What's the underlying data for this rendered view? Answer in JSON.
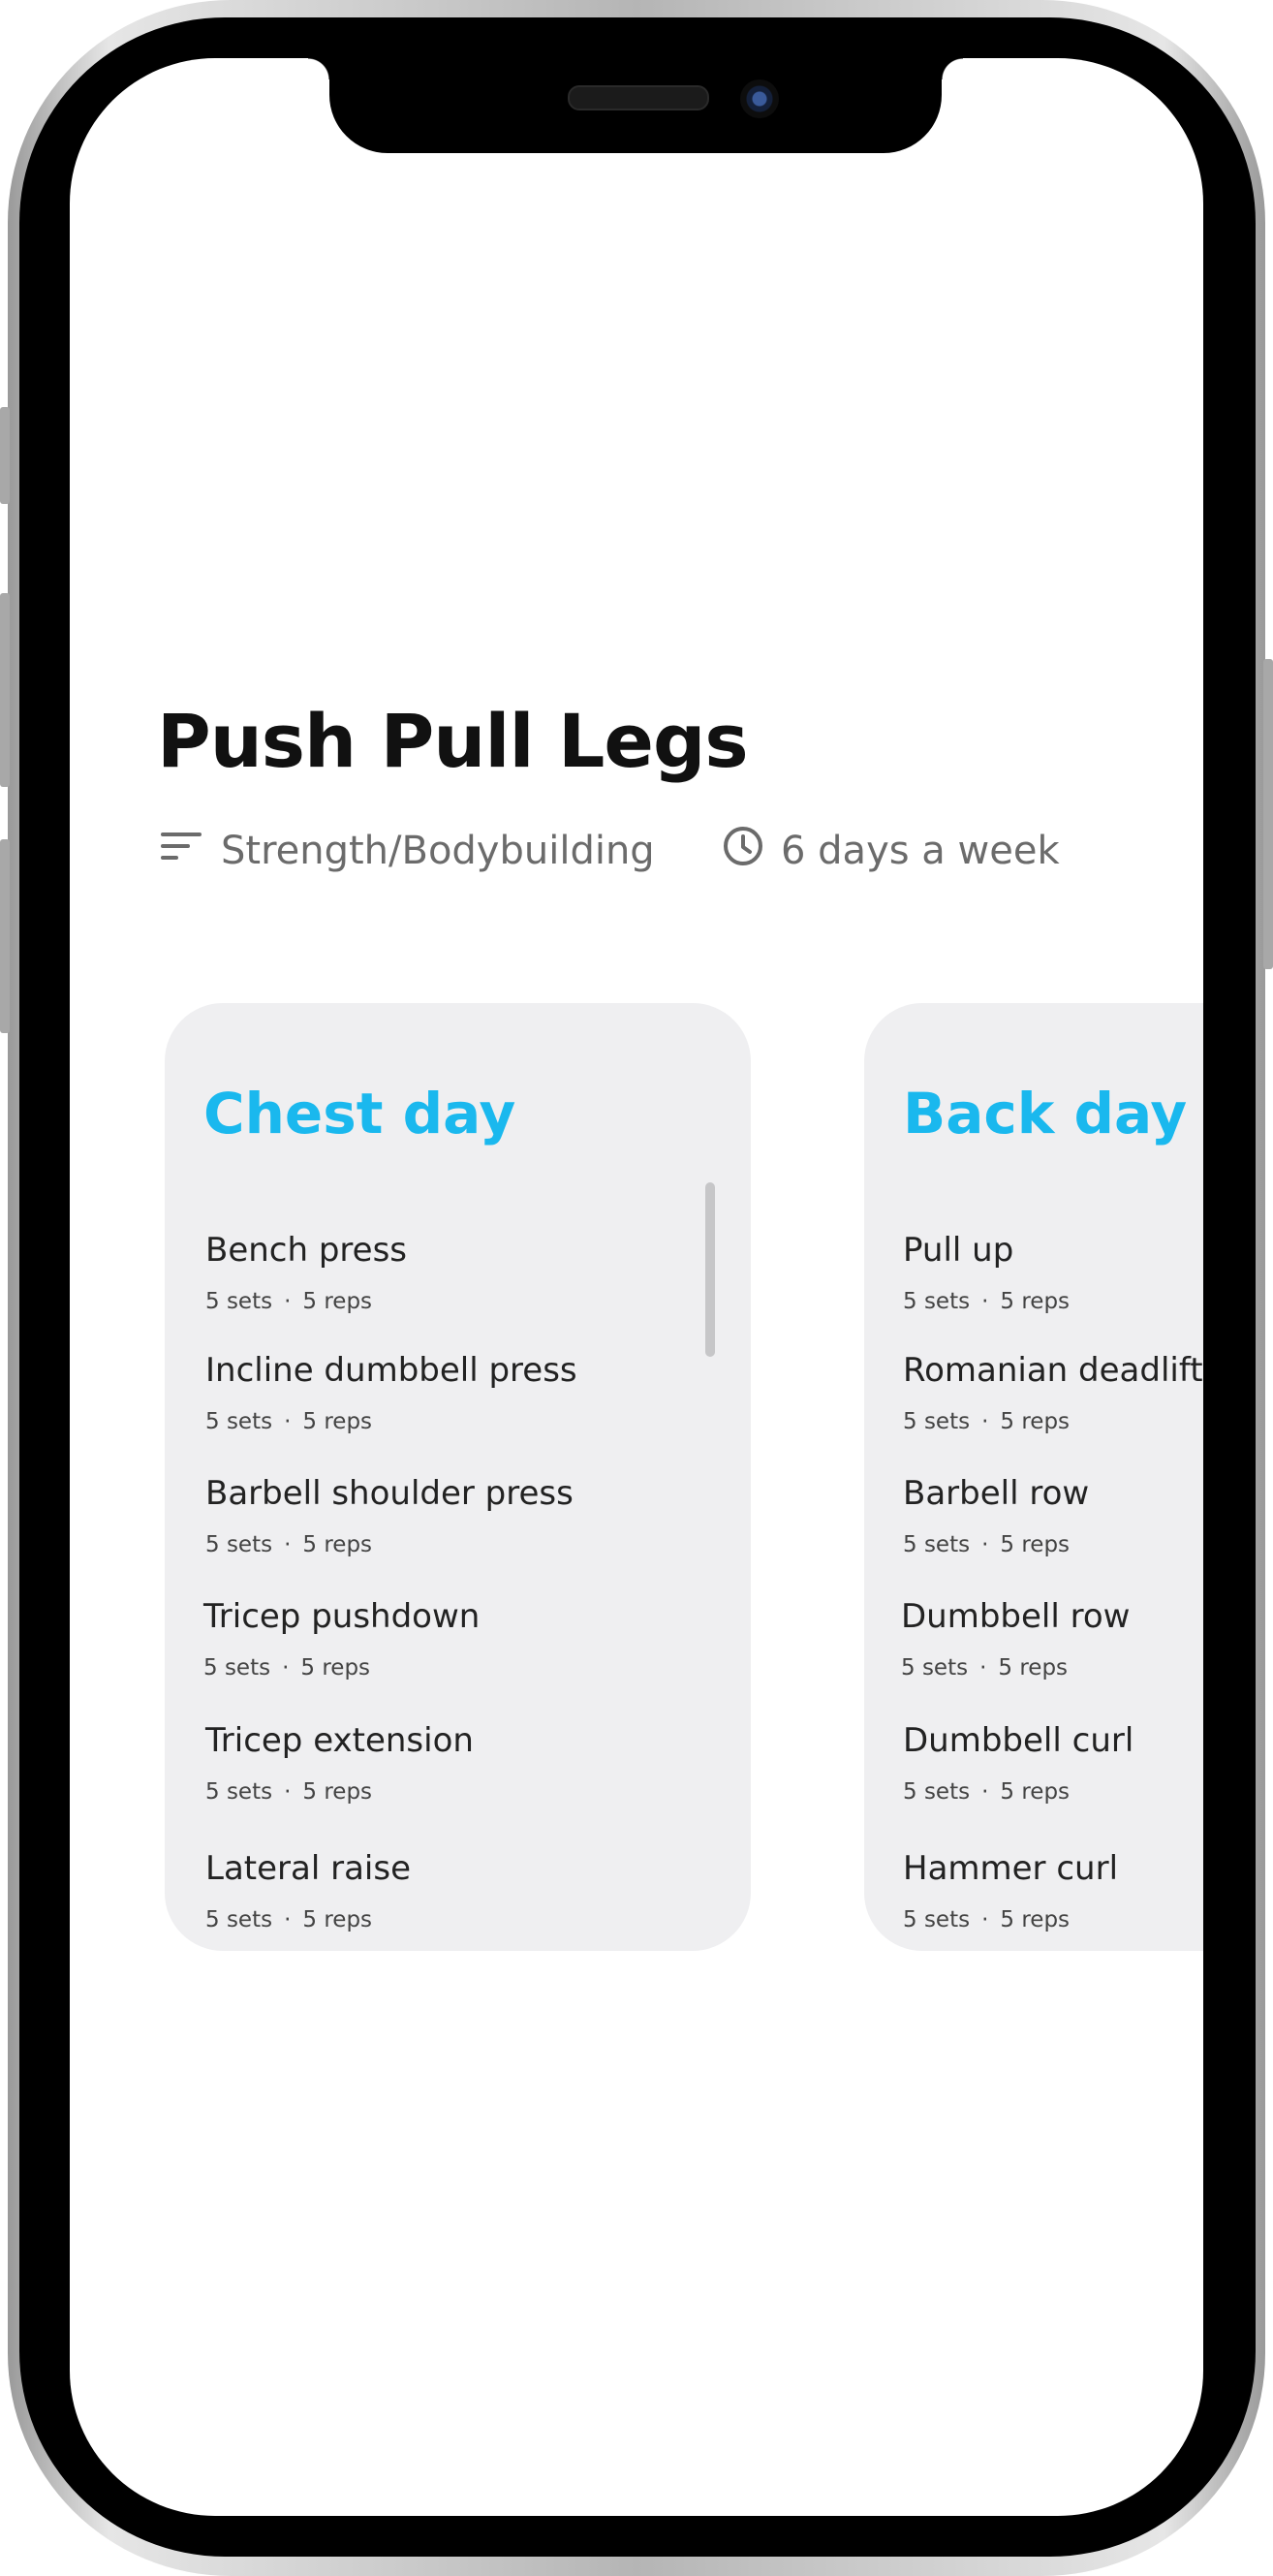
{
  "program": {
    "title": "Push Pull Legs",
    "category": "Strength/Bodybuilding",
    "frequency": "6 days a week",
    "category_icon": "filter-lines-icon",
    "frequency_icon": "clock-icon"
  },
  "colors": {
    "accent": "#1ab8ee",
    "card_background": "#efeff1",
    "title": "#111111",
    "meta": "#6b6b6b"
  },
  "days": [
    {
      "title": "Chest day",
      "exercises": [
        {
          "name": "Bench press",
          "sets": "5 sets",
          "reps": "5 reps"
        },
        {
          "name": "Incline dumbbell press",
          "sets": "5 sets",
          "reps": "5 reps"
        },
        {
          "name": "Barbell shoulder press",
          "sets": "5 sets",
          "reps": "5 reps"
        },
        {
          "name": "Tricep pushdown",
          "sets": "5 sets",
          "reps": "5 reps"
        },
        {
          "name": "Tricep extension",
          "sets": "5 sets",
          "reps": "5 reps"
        },
        {
          "name": "Lateral raise",
          "sets": "5 sets",
          "reps": "5 reps"
        }
      ]
    },
    {
      "title": "Back day",
      "exercises": [
        {
          "name": "Pull up",
          "sets": "5 sets",
          "reps": "5 reps"
        },
        {
          "name": "Romanian deadlift",
          "sets": "5 sets",
          "reps": "5 reps"
        },
        {
          "name": "Barbell row",
          "sets": "5 sets",
          "reps": "5 reps"
        },
        {
          "name": "Dumbbell row",
          "sets": "5 sets",
          "reps": "5 reps"
        },
        {
          "name": "Dumbbell curl",
          "sets": "5 sets",
          "reps": "5 reps"
        },
        {
          "name": "Hammer curl",
          "sets": "5 sets",
          "reps": "5 reps"
        }
      ]
    }
  ],
  "separator": "·"
}
